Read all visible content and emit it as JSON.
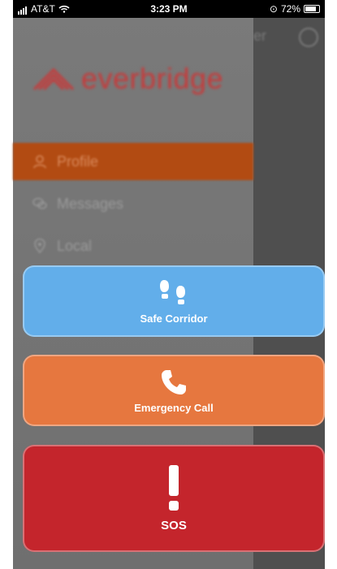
{
  "status_bar": {
    "carrier": "AT&T",
    "time": "3:23 PM",
    "battery": "72%"
  },
  "logo": {
    "word": "everbridge"
  },
  "menu": {
    "items": [
      {
        "label": "Profile"
      },
      {
        "label": "Messages"
      },
      {
        "label": "Local"
      }
    ]
  },
  "actions": {
    "safe_corridor": {
      "label": "Safe Corridor",
      "icon": "footprints-icon"
    },
    "emergency_call": {
      "label": "Emergency Call",
      "icon": "phone-icon"
    },
    "sos": {
      "label": "SOS",
      "icon": "exclamation-icon"
    }
  },
  "colors": {
    "safe_corridor": "#62aeea",
    "emergency_call": "#e6773f",
    "sos": "#c4252c",
    "profile_highlight": "#b24b12",
    "logo_red": "#c73a3a"
  }
}
